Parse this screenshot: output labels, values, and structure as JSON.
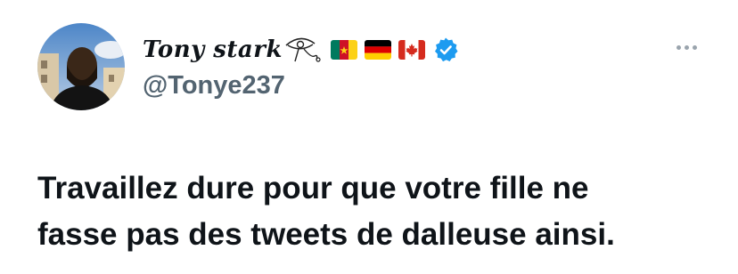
{
  "tweet": {
    "display_name": "Tony stark",
    "handle": "@Tonye237",
    "text_lines": [
      "Travaillez dure pour que votre fille ne",
      "fasse pas des tweets de dalleuse ainsi."
    ],
    "header_icons": [
      "eye-of-horus-icon",
      "cameroon-flag-icon",
      "germany-flag-icon",
      "canada-flag-icon",
      "verified-badge-icon"
    ],
    "more_icon": "more-options-icon"
  },
  "colors": {
    "text": "#0f1419",
    "secondary": "#536471",
    "verified": "#1d9bf0",
    "background": "#ffffff"
  }
}
